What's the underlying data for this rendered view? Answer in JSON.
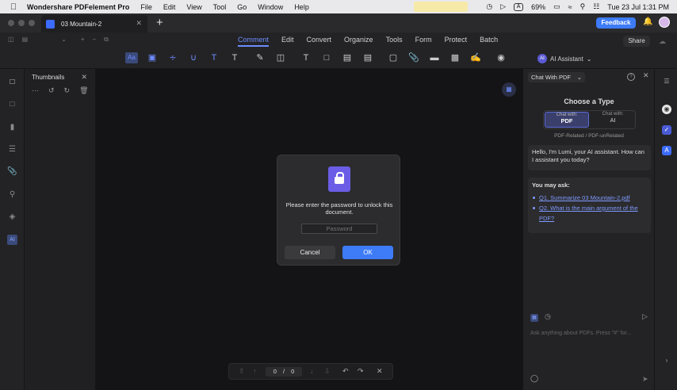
{
  "menubar": {
    "app_name": "Wondershare PDFelement Pro",
    "items": [
      "File",
      "Edit",
      "View",
      "Tool",
      "Go",
      "Window",
      "Help"
    ],
    "battery": "69%",
    "datetime": "Tue 23 Jul  1:31 PM"
  },
  "titlebar": {
    "tab_title": "03 Mountain-2",
    "feedback_label": "Feedback"
  },
  "toolbar": {
    "tabs": [
      "Comment",
      "Edit",
      "Convert",
      "Organize",
      "Tools",
      "Form",
      "Protect",
      "Batch"
    ],
    "active_tab": "Comment",
    "share_label": "Share",
    "ai_assistant_label": "AI Assistant",
    "ai_badge": "AI",
    "tool_aa": "Aa"
  },
  "sidebar": {
    "title": "Thumbnails",
    "ai_label": "AI"
  },
  "dialog": {
    "message": "Please enter the password to unlock this document.",
    "password_placeholder": "Password",
    "cancel_label": "Cancel",
    "ok_label": "OK"
  },
  "pager": {
    "current": "0",
    "separator": "/",
    "total": "0"
  },
  "chat": {
    "selector": "Chat With PDF",
    "choose_title": "Choose a Type",
    "option_pdf_sub": "Chat with:",
    "option_pdf": "PDF",
    "option_ai_sub": "Chat with:",
    "option_ai": "AI",
    "related_text": "PDF-Related / PDF-unRelated",
    "greeting": "Hello, I'm Lumi, your AI assistant. How can I assistant you today?",
    "you_may_ask": "You may ask:",
    "questions": [
      "Q1. Summarize 03 Mountain-2.pdf",
      "Q2. What is the main argument of the PDF?"
    ],
    "input_placeholder": "Ask anything about PDFs. Press \"#\" for..."
  },
  "colors": {
    "accent": "#3d7bf7",
    "link": "#7f9aff"
  }
}
